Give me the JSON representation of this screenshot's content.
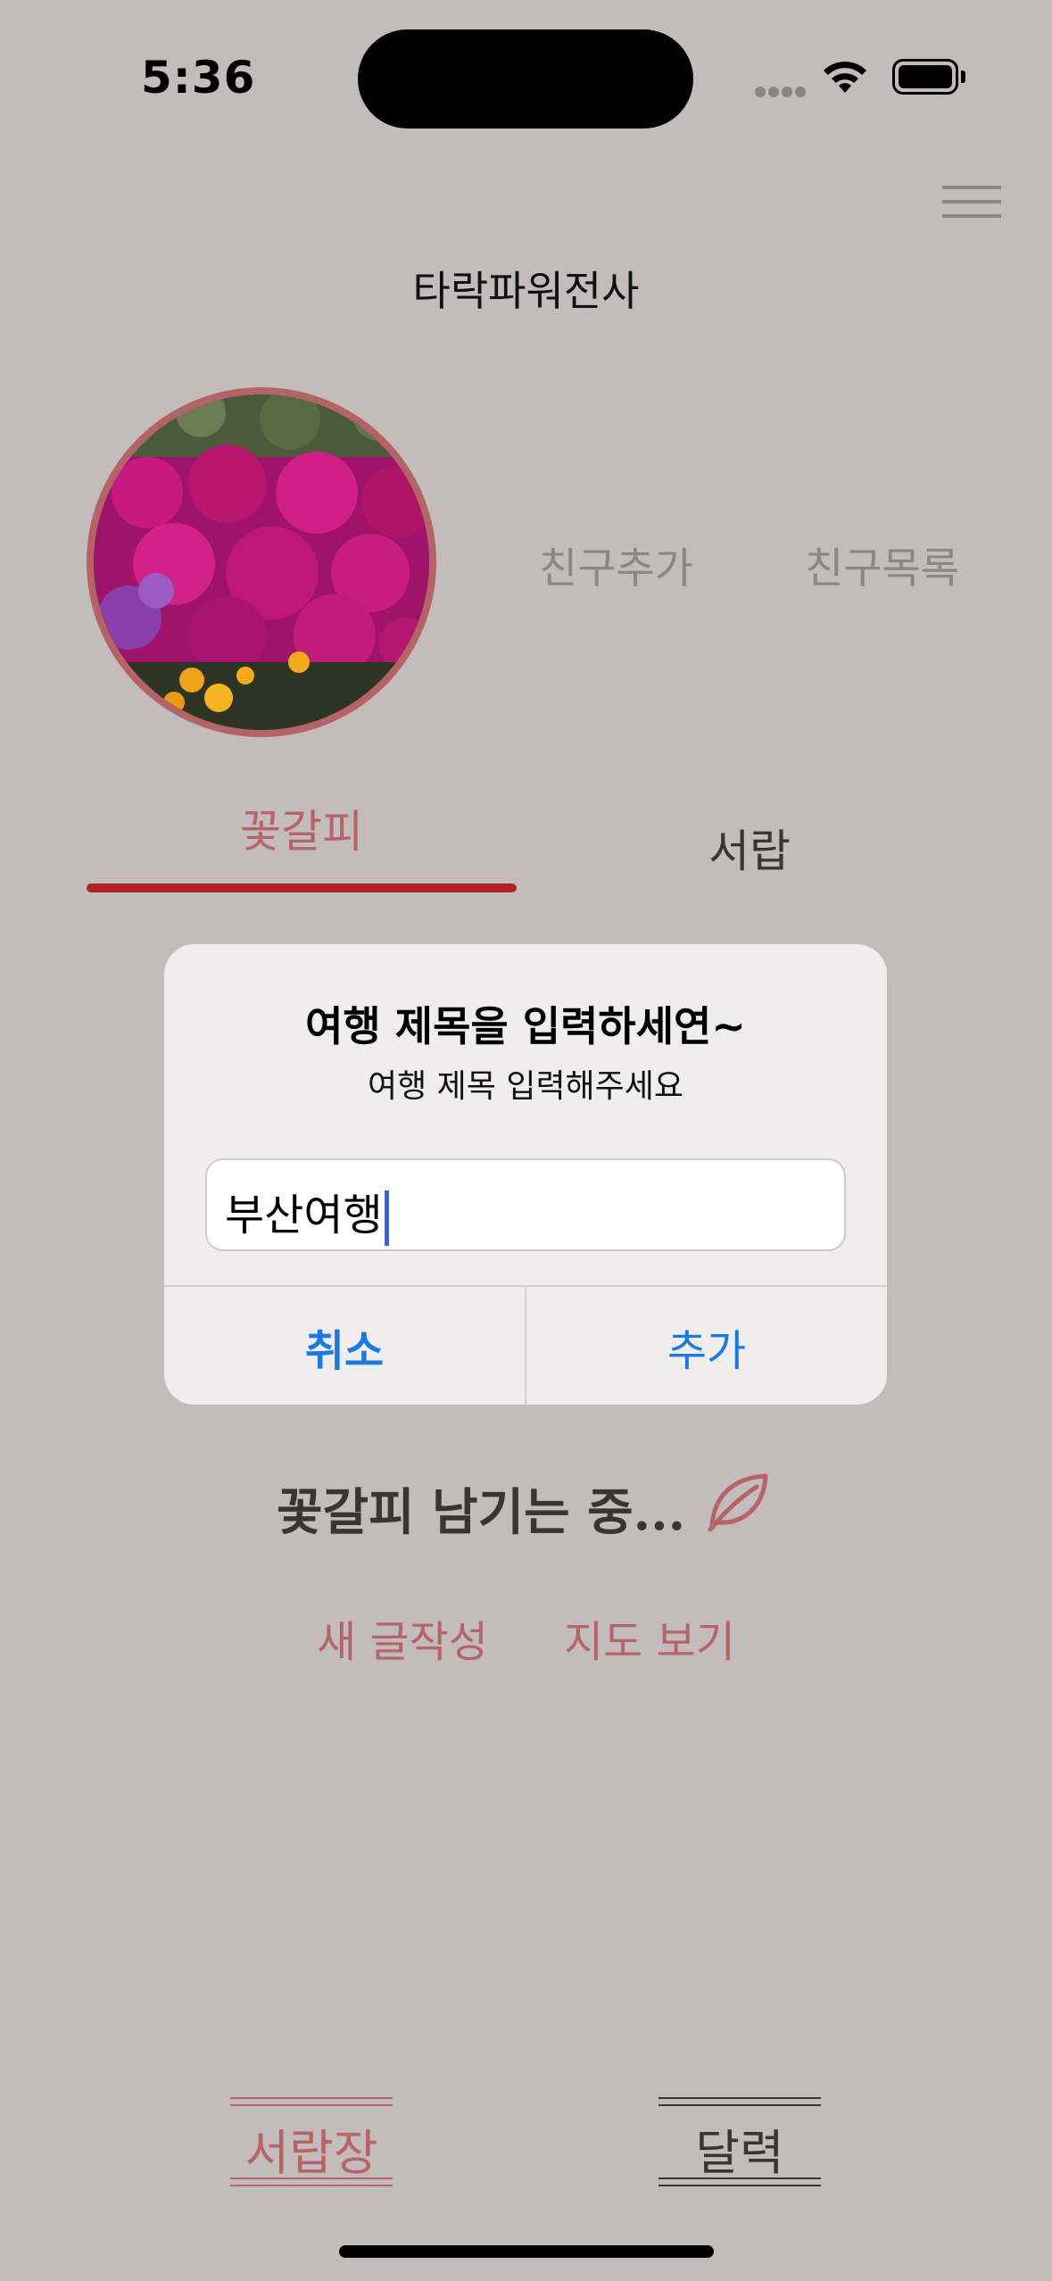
{
  "status_bar": {
    "time": "5:36"
  },
  "header": {
    "username": "타락파워전사",
    "menu_icon": "hamburger-menu-icon"
  },
  "profile": {
    "friend_add": "친구추가",
    "friend_list": "친구목록"
  },
  "tabs": [
    {
      "label": "꽃갈피",
      "active": true
    },
    {
      "label": "서랍",
      "active": false
    }
  ],
  "dialog": {
    "title": "여행 제목을 입력하세연~",
    "message": "여행 제목 입력해주세요",
    "input_value": "부산여행",
    "cancel": "취소",
    "add": "추가"
  },
  "main": {
    "status_text": "꽃갈피 남기는 중...",
    "new_post": "새 글작성",
    "map_view": "지도 보기"
  },
  "bottom": {
    "drawer": "서랍장",
    "calendar": "달력"
  },
  "colors": {
    "background": "#c4bcbc",
    "accent": "#b56468",
    "tab_underline": "#b21f24",
    "dialog_button": "#1a7ae0"
  }
}
